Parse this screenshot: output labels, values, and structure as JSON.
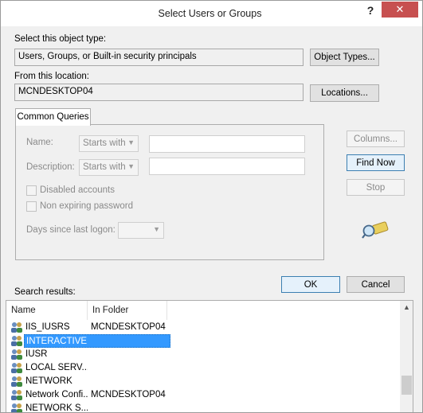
{
  "window": {
    "title": "Select Users or Groups",
    "help": "?",
    "close": "✕"
  },
  "object_type": {
    "label": "Select this object type:",
    "value": "Users, Groups, or Built-in security principals",
    "button": "Object Types..."
  },
  "location": {
    "label": "From this location:",
    "value": "MCNDESKTOP04",
    "button": "Locations..."
  },
  "queries": {
    "tab": "Common Queries",
    "name_label": "Name:",
    "name_mode": "Starts with",
    "description_label": "Description:",
    "description_mode": "Starts with",
    "disabled_accounts": "Disabled accounts",
    "non_expiring_password": "Non expiring password",
    "days_since_logon": "Days since last logon:",
    "columns_button": "Columns...",
    "find_now_button": "Find Now",
    "stop_button": "Stop"
  },
  "actions": {
    "ok": "OK",
    "cancel": "Cancel"
  },
  "results": {
    "label": "Search results:",
    "columns": [
      "Name",
      "In Folder"
    ],
    "rows": [
      {
        "name": "IIS_IUSRS",
        "folder": "MCNDESKTOP04"
      },
      {
        "name": "INTERACTIVE",
        "folder": ""
      },
      {
        "name": "IUSR",
        "folder": ""
      },
      {
        "name": "LOCAL SERV...",
        "folder": ""
      },
      {
        "name": "NETWORK",
        "folder": ""
      },
      {
        "name": "Network Confi...",
        "folder": "MCNDESKTOP04"
      },
      {
        "name": "NETWORK S...",
        "folder": ""
      }
    ]
  },
  "colors": {
    "selection": "#3399ff",
    "close_button": "#c75050",
    "default_button_border": "#3c7fb1"
  }
}
